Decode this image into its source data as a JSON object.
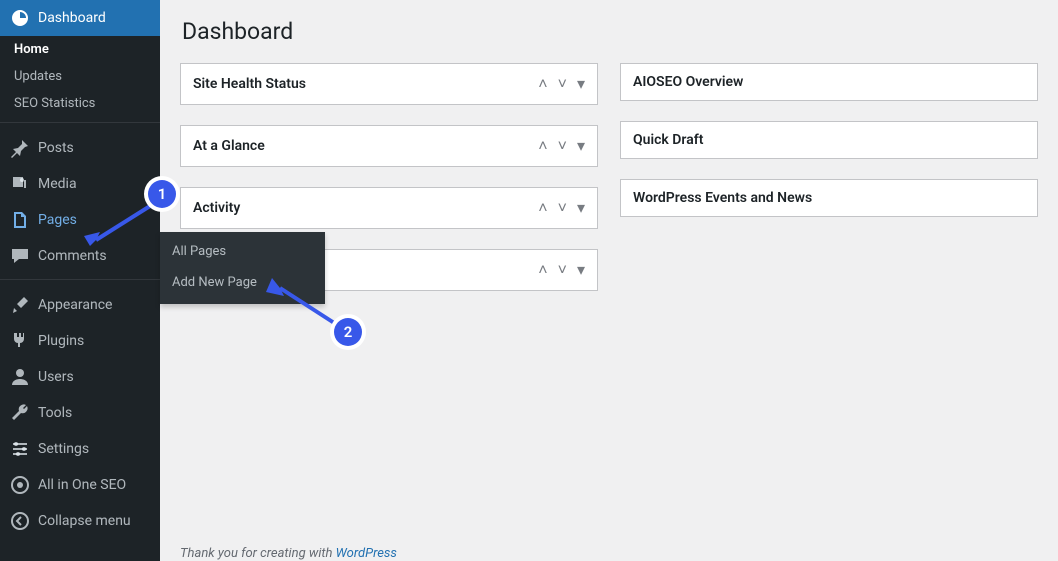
{
  "sidebar": {
    "dashboard": "Dashboard",
    "home": "Home",
    "updates": "Updates",
    "seo_stats": "SEO Statistics",
    "posts": "Posts",
    "media": "Media",
    "pages": "Pages",
    "comments": "Comments",
    "appearance": "Appearance",
    "plugins": "Plugins",
    "users": "Users",
    "tools": "Tools",
    "settings": "Settings",
    "aioseo": "All in One SEO",
    "collapse": "Collapse menu"
  },
  "flyout": {
    "all_pages": "All Pages",
    "add_new": "Add New Page"
  },
  "page": {
    "title": "Dashboard"
  },
  "panels_left": [
    "Site Health Status",
    "At a Glance",
    "Activity",
    ""
  ],
  "panels_right": [
    "AIOSEO Overview",
    "Quick Draft",
    "WordPress Events and News"
  ],
  "footer": {
    "prefix": "Thank you for creating with ",
    "link": "WordPress"
  },
  "callouts": {
    "c1": "1",
    "c2": "2"
  }
}
